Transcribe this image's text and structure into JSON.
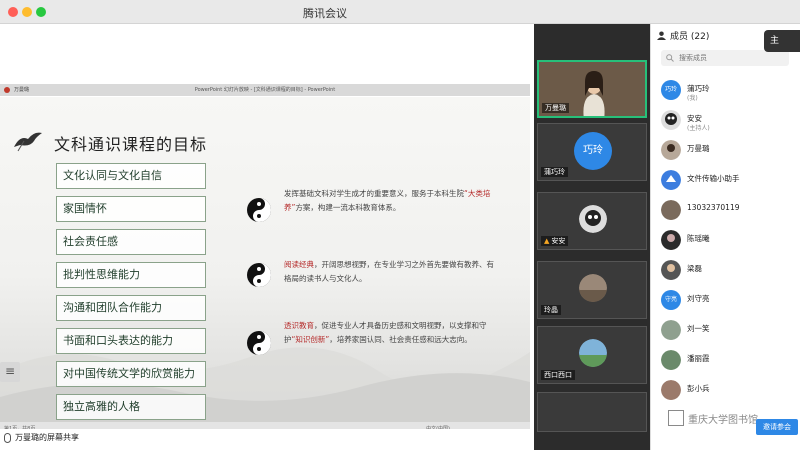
{
  "app": {
    "title": "腾讯会议"
  },
  "ppt": {
    "window_title": "PowerPoint 幻灯片放映 - [文科通识课程的目标] - PowerPoint",
    "owner": "万曼璐"
  },
  "slide": {
    "title": "文科通识课程的目标",
    "goals": [
      "文化认同与文化自信",
      "家国情怀",
      "社会责任感",
      "批判性思维能力",
      "沟通和团队合作能力",
      "书面和口头表达的能力",
      "对中国传统文学的欣赏能力",
      "独立高雅的人格"
    ],
    "desc1_a": "发挥基础文科对学生成才的重要意义，服务于本科生院",
    "desc1_hl": "“大类培养”",
    "desc1_b": "方案，构建一流本科教育体系。",
    "desc2_hl": "阅读经典",
    "desc2_b": "，开阔思想视野，在专业学习之外首先要做有教养、有格局的读书人与文化人。",
    "desc3_hl1": "透识教育",
    "desc3_a": "，促进专业人才具备历史感和文明视野，以支撑和守护",
    "desc3_hl2": "“知识创新”",
    "desc3_b": "，培养家国认同、社会责任感和远大志向。",
    "footer_left": "第1页，共8页",
    "footer_right": "中文(中国)"
  },
  "bottombar": {
    "share_label": "万曼璐的屏幕共享"
  },
  "videos": [
    {
      "name": "万曼璐",
      "type": "photo",
      "active": true
    },
    {
      "name": "蒲巧玲",
      "type": "text",
      "avatar_text": "巧玲"
    },
    {
      "name": "安安",
      "type": "photo"
    },
    {
      "name": "玲晶",
      "type": "photo"
    },
    {
      "name": "西口西口",
      "type": "photo"
    }
  ],
  "members_panel": {
    "header": "成员 (22)",
    "search_placeholder": "搜索成员",
    "members": [
      {
        "name": "蒲巧玲",
        "sub": "(我)",
        "avatar_text": "巧玲",
        "type": "text"
      },
      {
        "name": "安安",
        "sub": "(主持人)",
        "type": "photo"
      },
      {
        "name": "万曼璐",
        "sub": "",
        "type": "photo"
      },
      {
        "name": "文件传输小助手",
        "sub": "",
        "type": "photo"
      },
      {
        "name": "13032370119",
        "sub": "",
        "type": "photo"
      },
      {
        "name": "陈瑶曦",
        "sub": "",
        "type": "photo"
      },
      {
        "name": "梁磊",
        "sub": "",
        "type": "photo"
      },
      {
        "name": "刘守亮",
        "sub": "",
        "avatar_text": "守亮",
        "type": "text"
      },
      {
        "name": "刘一笑",
        "sub": "",
        "type": "photo"
      },
      {
        "name": "潘丽霞",
        "sub": "",
        "type": "photo"
      },
      {
        "name": "彭小兵",
        "sub": "",
        "type": "photo"
      }
    ],
    "invite_label": "邀请参会"
  },
  "watermark": {
    "text": "重庆大学图书馆"
  },
  "float_pill": {
    "label": "主"
  },
  "colors": {
    "accent": "#2e88e6",
    "active_border": "#27c07a",
    "highlight_red": "#b52a2a"
  }
}
